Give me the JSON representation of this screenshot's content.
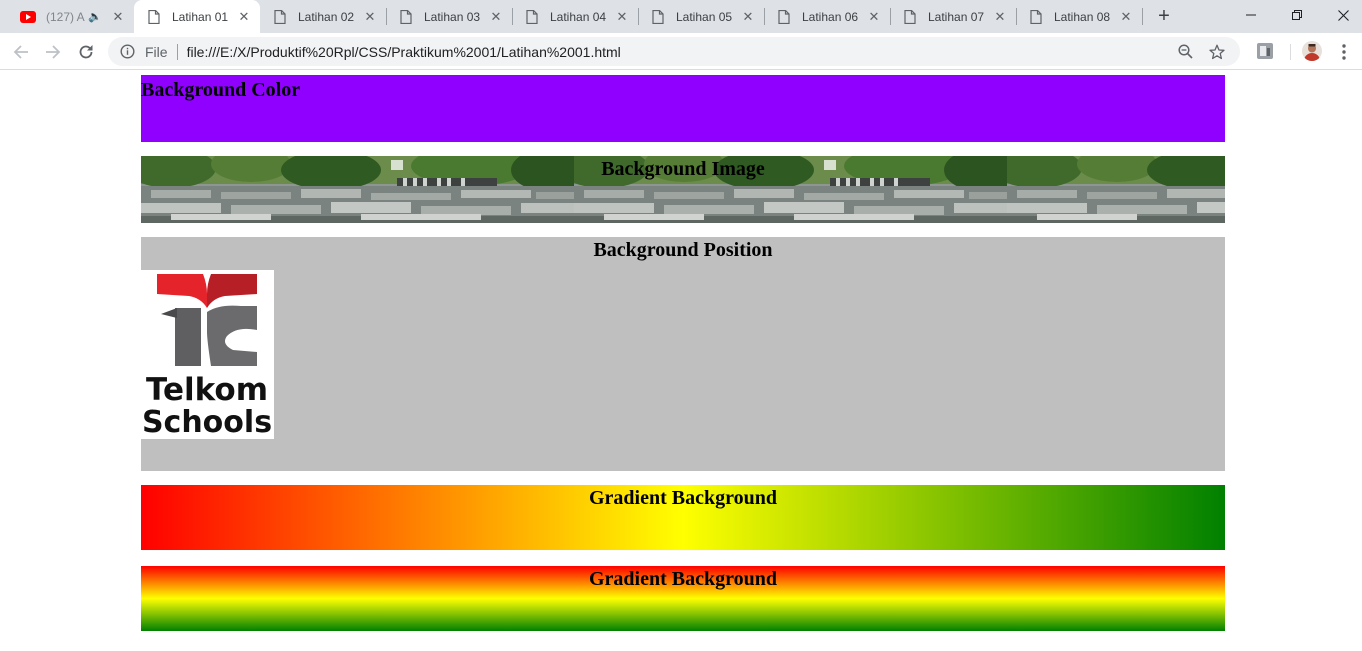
{
  "browser": {
    "tabs": [
      {
        "title": "(127) A",
        "icon": "youtube-icon",
        "muted": true,
        "active": false
      },
      {
        "title": "Latihan 01",
        "icon": "file-icon",
        "active": true
      },
      {
        "title": "Latihan 02",
        "icon": "file-icon",
        "active": false
      },
      {
        "title": "Latihan 03",
        "icon": "file-icon",
        "active": false
      },
      {
        "title": "Latihan 04",
        "icon": "file-icon",
        "active": false
      },
      {
        "title": "Latihan 05",
        "icon": "file-icon",
        "active": false
      },
      {
        "title": "Latihan 06",
        "icon": "file-icon",
        "active": false
      },
      {
        "title": "Latihan 07",
        "icon": "file-icon",
        "active": false
      },
      {
        "title": "Latihan 08",
        "icon": "file-icon",
        "active": false
      }
    ],
    "omnibox": {
      "scheme_label": "File",
      "url": "file:///E:/X/Produktif%20Rpl/CSS/Praktikum%2001/Latihan%2001.html"
    }
  },
  "page": {
    "sections": {
      "color": {
        "heading": "Background Color",
        "bg": "#8f00ff"
      },
      "image": {
        "heading": "Background Image"
      },
      "position": {
        "heading": "Background Position",
        "bg": "#bfbfbf"
      },
      "gradient_h": {
        "heading": "Gradient Background",
        "colors": [
          "#ff0000",
          "#ffff00",
          "#008000"
        ],
        "direction": "to right"
      },
      "gradient_v": {
        "heading": "Gradient Background",
        "colors": [
          "#ff0000",
          "#ffff00",
          "#008000"
        ],
        "direction": "to bottom"
      }
    },
    "logo": {
      "line1": "Telkom",
      "line2": "Schools"
    }
  }
}
